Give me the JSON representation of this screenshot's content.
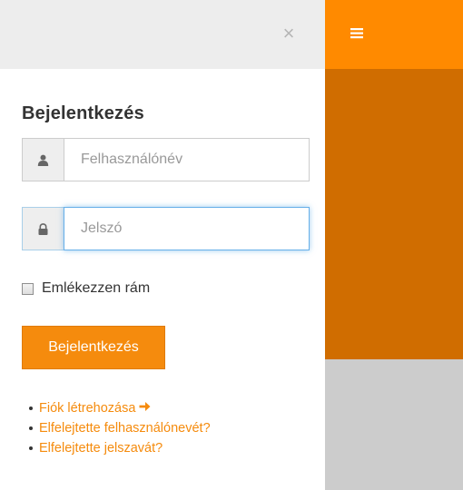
{
  "panel": {
    "close_glyph": "×",
    "title": "Bejelentkezés",
    "username": {
      "icon": "user-icon",
      "placeholder": "Felhasználónév",
      "value": ""
    },
    "password": {
      "icon": "lock-icon",
      "placeholder": "Jelszó",
      "value": ""
    },
    "remember_label": "Emlékezzen rám",
    "remember_checked": false,
    "login_label": "Bejelentkezés",
    "links": [
      {
        "label": "Fiók létrehozása",
        "icon": "arrow-right-icon"
      },
      {
        "label": "Elfelejtette felhasználónevét?"
      },
      {
        "label": "Elfelejtette jelszavát?"
      }
    ]
  },
  "header": {
    "menu_icon": "hamburger-menu-icon"
  },
  "colors": {
    "accent": "#ff8a00",
    "accent_dark": "#d06d00",
    "button": "#f58b0d",
    "panel_header": "#ededed",
    "backdrop_gray": "#cccccc",
    "focus_border": "#66afe9"
  }
}
